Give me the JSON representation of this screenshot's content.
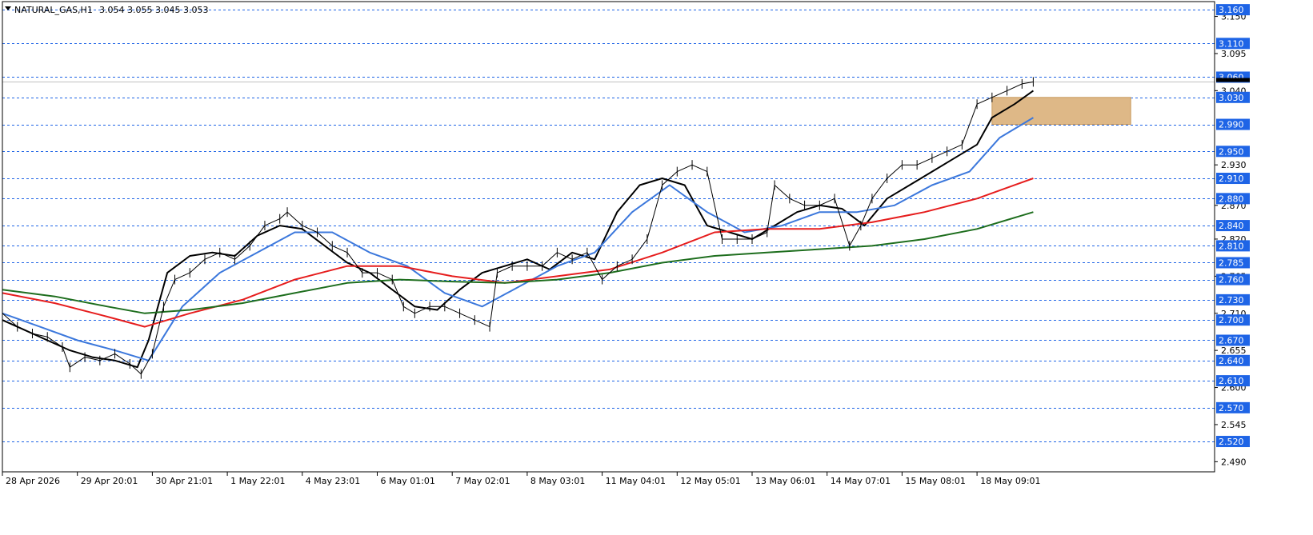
{
  "header": {
    "symbol": "NATURAL_GAS,H1",
    "ohlc": "3.054 3.055 3.045 3.053"
  },
  "chart_data": {
    "type": "line",
    "title": "",
    "xlabel": "",
    "ylabel": "",
    "ylim": [
      2.475,
      3.172
    ],
    "x_ticks": [
      "28 Apr 2026",
      "29 Apr 20:01",
      "30 Apr 21:01",
      "1 May 22:01",
      "4 May 23:01",
      "6 May 01:01",
      "7 May 02:01",
      "8 May 03:01",
      "11 May 04:01",
      "12 May 05:01",
      "13 May 06:01",
      "14 May 07:01",
      "15 May 08:01",
      "18 May 09:01"
    ],
    "y_ticks": [
      3.15,
      3.095,
      3.04,
      2.93,
      2.87,
      2.82,
      2.765,
      2.71,
      2.655,
      2.6,
      2.545,
      2.49
    ],
    "price_levels": [
      3.16,
      3.11,
      3.06,
      3.03,
      2.99,
      2.95,
      2.91,
      2.88,
      2.84,
      2.81,
      2.785,
      2.76,
      2.73,
      2.7,
      2.67,
      2.64,
      2.61,
      2.57,
      2.52
    ],
    "current_price": 3.053,
    "zone": {
      "x_start": 13.2,
      "x_end": 15.05,
      "y_low": 2.99,
      "y_high": 3.03,
      "color": "#deb887"
    },
    "colors": {
      "level_tag": "#1e64e6",
      "level_line": "#1e64e6",
      "grid_axis": "#000000"
    },
    "series": [
      {
        "color": "#000000",
        "x": [
          0,
          0.3,
          0.6,
          0.9,
          1.2,
          1.5,
          1.8,
          1.95,
          2.2,
          2.5,
          2.8,
          3.1,
          3.4,
          3.7,
          4.0,
          4.3,
          4.6,
          4.9,
          5.2,
          5.5,
          5.8,
          6.1,
          6.4,
          6.7,
          7.0,
          7.3,
          7.6,
          7.9,
          8.2,
          8.5,
          8.8,
          9.1,
          9.4,
          9.7,
          10.0,
          10.3,
          10.6,
          10.9,
          11.2,
          11.5,
          11.8,
          12.1,
          12.4,
          12.7,
          13.0,
          13.2,
          13.5,
          13.75
        ],
        "values": [
          2.7,
          2.685,
          2.67,
          2.655,
          2.645,
          2.64,
          2.63,
          2.67,
          2.77,
          2.795,
          2.8,
          2.795,
          2.825,
          2.84,
          2.835,
          2.81,
          2.785,
          2.77,
          2.745,
          2.72,
          2.715,
          2.745,
          2.77,
          2.78,
          2.79,
          2.775,
          2.8,
          2.79,
          2.86,
          2.9,
          2.91,
          2.9,
          2.84,
          2.83,
          2.82,
          2.84,
          2.86,
          2.87,
          2.865,
          2.84,
          2.88,
          2.9,
          2.92,
          2.94,
          2.96,
          3.0,
          3.02,
          3.04
        ]
      },
      {
        "color": "#3c78dc",
        "x": [
          0,
          0.5,
          1.0,
          1.5,
          1.95,
          2.4,
          2.9,
          3.4,
          3.9,
          4.4,
          4.9,
          5.4,
          5.9,
          6.4,
          6.9,
          7.4,
          7.9,
          8.4,
          8.9,
          9.4,
          9.9,
          10.4,
          10.9,
          11.4,
          11.9,
          12.4,
          12.9,
          13.3,
          13.75
        ],
        "values": [
          2.71,
          2.69,
          2.67,
          2.655,
          2.64,
          2.72,
          2.77,
          2.8,
          2.83,
          2.83,
          2.8,
          2.78,
          2.74,
          2.72,
          2.75,
          2.78,
          2.8,
          2.86,
          2.9,
          2.86,
          2.83,
          2.84,
          2.86,
          2.86,
          2.87,
          2.9,
          2.92,
          2.97,
          3.0
        ]
      },
      {
        "color": "#e61e1e",
        "x": [
          0,
          0.7,
          1.4,
          1.9,
          2.5,
          3.2,
          3.9,
          4.6,
          5.3,
          6.0,
          6.7,
          7.4,
          8.1,
          8.8,
          9.5,
          10.2,
          10.9,
          11.6,
          12.3,
          13.0,
          13.75
        ],
        "values": [
          2.74,
          2.725,
          2.705,
          2.69,
          2.71,
          2.73,
          2.76,
          2.78,
          2.78,
          2.765,
          2.755,
          2.765,
          2.775,
          2.8,
          2.83,
          2.835,
          2.835,
          2.845,
          2.86,
          2.88,
          2.91
        ]
      },
      {
        "color": "#1e6e1e",
        "x": [
          0,
          0.7,
          1.4,
          1.9,
          2.5,
          3.2,
          3.9,
          4.6,
          5.3,
          6.0,
          6.7,
          7.4,
          8.1,
          8.8,
          9.5,
          10.2,
          10.9,
          11.6,
          12.3,
          13.0,
          13.75
        ],
        "values": [
          2.745,
          2.735,
          2.72,
          2.71,
          2.715,
          2.725,
          2.74,
          2.755,
          2.76,
          2.757,
          2.755,
          2.76,
          2.77,
          2.785,
          2.795,
          2.8,
          2.805,
          2.81,
          2.82,
          2.835,
          2.86
        ]
      },
      {
        "color": "#000000",
        "x": [
          0,
          0.2,
          0.4,
          0.6,
          0.8,
          0.9,
          1.1,
          1.3,
          1.5,
          1.7,
          1.85,
          2.0,
          2.15,
          2.3,
          2.5,
          2.7,
          2.9,
          3.1,
          3.3,
          3.5,
          3.7,
          3.8,
          4.0,
          4.2,
          4.4,
          4.6,
          4.8,
          5.0,
          5.2,
          5.35,
          5.5,
          5.7,
          5.9,
          6.1,
          6.3,
          6.5,
          6.6,
          6.8,
          7.0,
          7.2,
          7.4,
          7.6,
          7.8,
          8.0,
          8.2,
          8.4,
          8.6,
          8.8,
          9.0,
          9.2,
          9.4,
          9.6,
          9.8,
          10.0,
          10.2,
          10.3,
          10.5,
          10.7,
          10.9,
          11.1,
          11.3,
          11.45,
          11.6,
          11.8,
          12.0,
          12.2,
          12.4,
          12.6,
          12.8,
          13.0,
          13.2,
          13.4,
          13.6,
          13.75
        ],
        "values": [
          2.71,
          2.69,
          2.68,
          2.675,
          2.66,
          2.63,
          2.645,
          2.64,
          2.65,
          2.635,
          2.62,
          2.65,
          2.72,
          2.76,
          2.77,
          2.79,
          2.8,
          2.79,
          2.81,
          2.84,
          2.85,
          2.86,
          2.84,
          2.83,
          2.81,
          2.8,
          2.77,
          2.77,
          2.76,
          2.72,
          2.71,
          2.72,
          2.72,
          2.71,
          2.7,
          2.69,
          2.77,
          2.78,
          2.78,
          2.78,
          2.8,
          2.79,
          2.8,
          2.76,
          2.78,
          2.79,
          2.82,
          2.9,
          2.92,
          2.93,
          2.92,
          2.82,
          2.82,
          2.82,
          2.83,
          2.9,
          2.88,
          2.87,
          2.87,
          2.88,
          2.81,
          2.84,
          2.88,
          2.91,
          2.93,
          2.93,
          2.94,
          2.95,
          2.96,
          3.02,
          3.03,
          3.04,
          3.05,
          3.053
        ]
      }
    ]
  }
}
